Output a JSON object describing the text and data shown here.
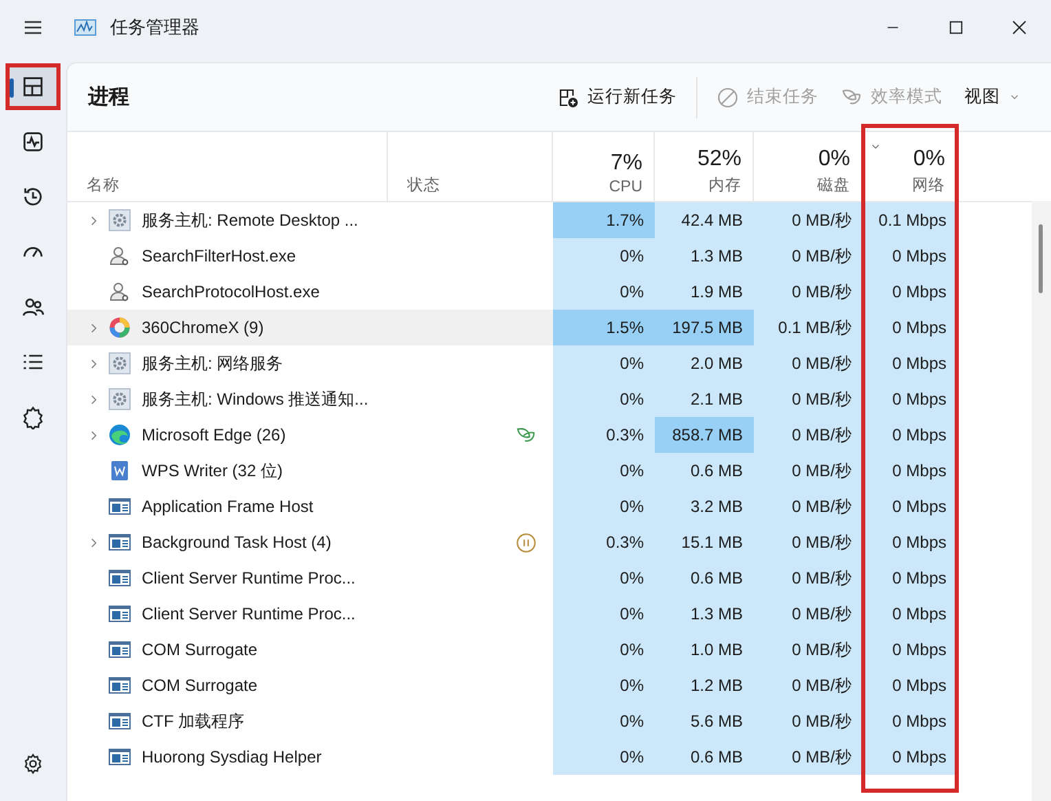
{
  "window": {
    "title": "任务管理器"
  },
  "sidebar": {
    "items": [
      {
        "kind": "processes",
        "selected": true,
        "highlighted": true
      },
      {
        "kind": "performance",
        "selected": false,
        "highlighted": false
      },
      {
        "kind": "history",
        "selected": false,
        "highlighted": false
      },
      {
        "kind": "startup",
        "selected": false,
        "highlighted": false
      },
      {
        "kind": "users",
        "selected": false,
        "highlighted": false
      },
      {
        "kind": "details",
        "selected": false,
        "highlighted": false
      },
      {
        "kind": "services",
        "selected": false,
        "highlighted": false
      }
    ]
  },
  "page": {
    "title": "进程",
    "toolbar": [
      {
        "kind": "run",
        "label": "运行新任务",
        "disabled": false
      },
      {
        "kind": "end",
        "label": "结束任务",
        "disabled": true
      },
      {
        "kind": "efficiency",
        "label": "效率模式",
        "disabled": true
      },
      {
        "kind": "view",
        "label": "视图",
        "disabled": false
      }
    ]
  },
  "table": {
    "name_header": "名称",
    "status_header": "状态",
    "columns": [
      {
        "percent": "7%",
        "label": "CPU",
        "sorted": false,
        "highlighted": false
      },
      {
        "percent": "52%",
        "label": "内存",
        "sorted": false,
        "highlighted": false
      },
      {
        "percent": "0%",
        "label": "磁盘",
        "sorted": false,
        "highlighted": false
      },
      {
        "percent": "0%",
        "label": "网络",
        "sorted": true,
        "highlighted": true
      }
    ],
    "rows": [
      {
        "expandable": true,
        "kind": "gear",
        "name": "服务主机: Remote Desktop ...",
        "selected": false,
        "cells": [
          {
            "value": "1.7%",
            "hot": true
          },
          {
            "value": "42.4 MB",
            "hot": false
          },
          {
            "value": "0 MB/秒",
            "hot": false
          },
          {
            "value": "0.1 Mbps",
            "hot": false
          }
        ]
      },
      {
        "expandable": false,
        "kind": "user",
        "name": "SearchFilterHost.exe",
        "selected": false,
        "cells": [
          {
            "value": "0%",
            "hot": false
          },
          {
            "value": "1.3 MB",
            "hot": false
          },
          {
            "value": "0 MB/秒",
            "hot": false
          },
          {
            "value": "0 Mbps",
            "hot": false
          }
        ]
      },
      {
        "expandable": false,
        "kind": "user",
        "name": "SearchProtocolHost.exe",
        "selected": false,
        "cells": [
          {
            "value": "0%",
            "hot": false
          },
          {
            "value": "1.9 MB",
            "hot": false
          },
          {
            "value": "0 MB/秒",
            "hot": false
          },
          {
            "value": "0 Mbps",
            "hot": false
          }
        ]
      },
      {
        "expandable": true,
        "kind": "ring",
        "name": "360ChromeX (9)",
        "selected": true,
        "cells": [
          {
            "value": "1.5%",
            "hot": true
          },
          {
            "value": "197.5 MB",
            "hot": true
          },
          {
            "value": "0.1 MB/秒",
            "hot": false
          },
          {
            "value": "0 Mbps",
            "hot": false
          }
        ]
      },
      {
        "expandable": true,
        "kind": "gear",
        "name": "服务主机: 网络服务",
        "selected": false,
        "cells": [
          {
            "value": "0%",
            "hot": false
          },
          {
            "value": "2.0 MB",
            "hot": false
          },
          {
            "value": "0 MB/秒",
            "hot": false
          },
          {
            "value": "0 Mbps",
            "hot": false
          }
        ]
      },
      {
        "expandable": true,
        "kind": "gear",
        "name": "服务主机: Windows 推送通知...",
        "selected": false,
        "cells": [
          {
            "value": "0%",
            "hot": false
          },
          {
            "value": "2.1 MB",
            "hot": false
          },
          {
            "value": "0 MB/秒",
            "hot": false
          },
          {
            "value": "0 Mbps",
            "hot": false
          }
        ]
      },
      {
        "expandable": true,
        "kind": "swirl",
        "name": "Microsoft Edge (26)",
        "status": {
          "kind": "efficiency"
        },
        "selected": false,
        "cells": [
          {
            "value": "0.3%",
            "hot": false
          },
          {
            "value": "858.7 MB",
            "hot": true
          },
          {
            "value": "0 MB/秒",
            "hot": false
          },
          {
            "value": "0 Mbps",
            "hot": false
          }
        ]
      },
      {
        "expandable": false,
        "kind": "document",
        "name": "WPS Writer (32 位)",
        "selected": false,
        "cells": [
          {
            "value": "0%",
            "hot": false
          },
          {
            "value": "0.6 MB",
            "hot": false
          },
          {
            "value": "0 MB/秒",
            "hot": false
          },
          {
            "value": "0 Mbps",
            "hot": false
          }
        ]
      },
      {
        "expandable": false,
        "kind": "window",
        "name": "Application Frame Host",
        "selected": false,
        "cells": [
          {
            "value": "0%",
            "hot": false
          },
          {
            "value": "3.2 MB",
            "hot": false
          },
          {
            "value": "0 MB/秒",
            "hot": false
          },
          {
            "value": "0 Mbps",
            "hot": false
          }
        ]
      },
      {
        "expandable": true,
        "kind": "window",
        "name": "Background Task Host (4)",
        "status": {
          "kind": "suspended"
        },
        "selected": false,
        "cells": [
          {
            "value": "0.3%",
            "hot": false
          },
          {
            "value": "15.1 MB",
            "hot": false
          },
          {
            "value": "0 MB/秒",
            "hot": false
          },
          {
            "value": "0 Mbps",
            "hot": false
          }
        ]
      },
      {
        "expandable": false,
        "kind": "window",
        "name": "Client Server Runtime Proc...",
        "selected": false,
        "cells": [
          {
            "value": "0%",
            "hot": false
          },
          {
            "value": "0.6 MB",
            "hot": false
          },
          {
            "value": "0 MB/秒",
            "hot": false
          },
          {
            "value": "0 Mbps",
            "hot": false
          }
        ]
      },
      {
        "expandable": false,
        "kind": "window",
        "name": "Client Server Runtime Proc...",
        "selected": false,
        "cells": [
          {
            "value": "0%",
            "hot": false
          },
          {
            "value": "1.3 MB",
            "hot": false
          },
          {
            "value": "0 MB/秒",
            "hot": false
          },
          {
            "value": "0 Mbps",
            "hot": false
          }
        ]
      },
      {
        "expandable": false,
        "kind": "window",
        "name": "COM Surrogate",
        "selected": false,
        "cells": [
          {
            "value": "0%",
            "hot": false
          },
          {
            "value": "1.0 MB",
            "hot": false
          },
          {
            "value": "0 MB/秒",
            "hot": false
          },
          {
            "value": "0 Mbps",
            "hot": false
          }
        ]
      },
      {
        "expandable": false,
        "kind": "window",
        "name": "COM Surrogate",
        "selected": false,
        "cells": [
          {
            "value": "0%",
            "hot": false
          },
          {
            "value": "1.2 MB",
            "hot": false
          },
          {
            "value": "0 MB/秒",
            "hot": false
          },
          {
            "value": "0 Mbps",
            "hot": false
          }
        ]
      },
      {
        "expandable": false,
        "kind": "window",
        "name": "CTF 加载程序",
        "selected": false,
        "cells": [
          {
            "value": "0%",
            "hot": false
          },
          {
            "value": "5.6 MB",
            "hot": false
          },
          {
            "value": "0 MB/秒",
            "hot": false
          },
          {
            "value": "0 Mbps",
            "hot": false
          }
        ]
      },
      {
        "expandable": false,
        "kind": "window",
        "name": "Huorong Sysdiag Helper",
        "selected": false,
        "cells": [
          {
            "value": "0%",
            "hot": false
          },
          {
            "value": "0.6 MB",
            "hot": false
          },
          {
            "value": "0 MB/秒",
            "hot": false
          },
          {
            "value": "0 Mbps",
            "hot": false
          }
        ]
      }
    ]
  }
}
